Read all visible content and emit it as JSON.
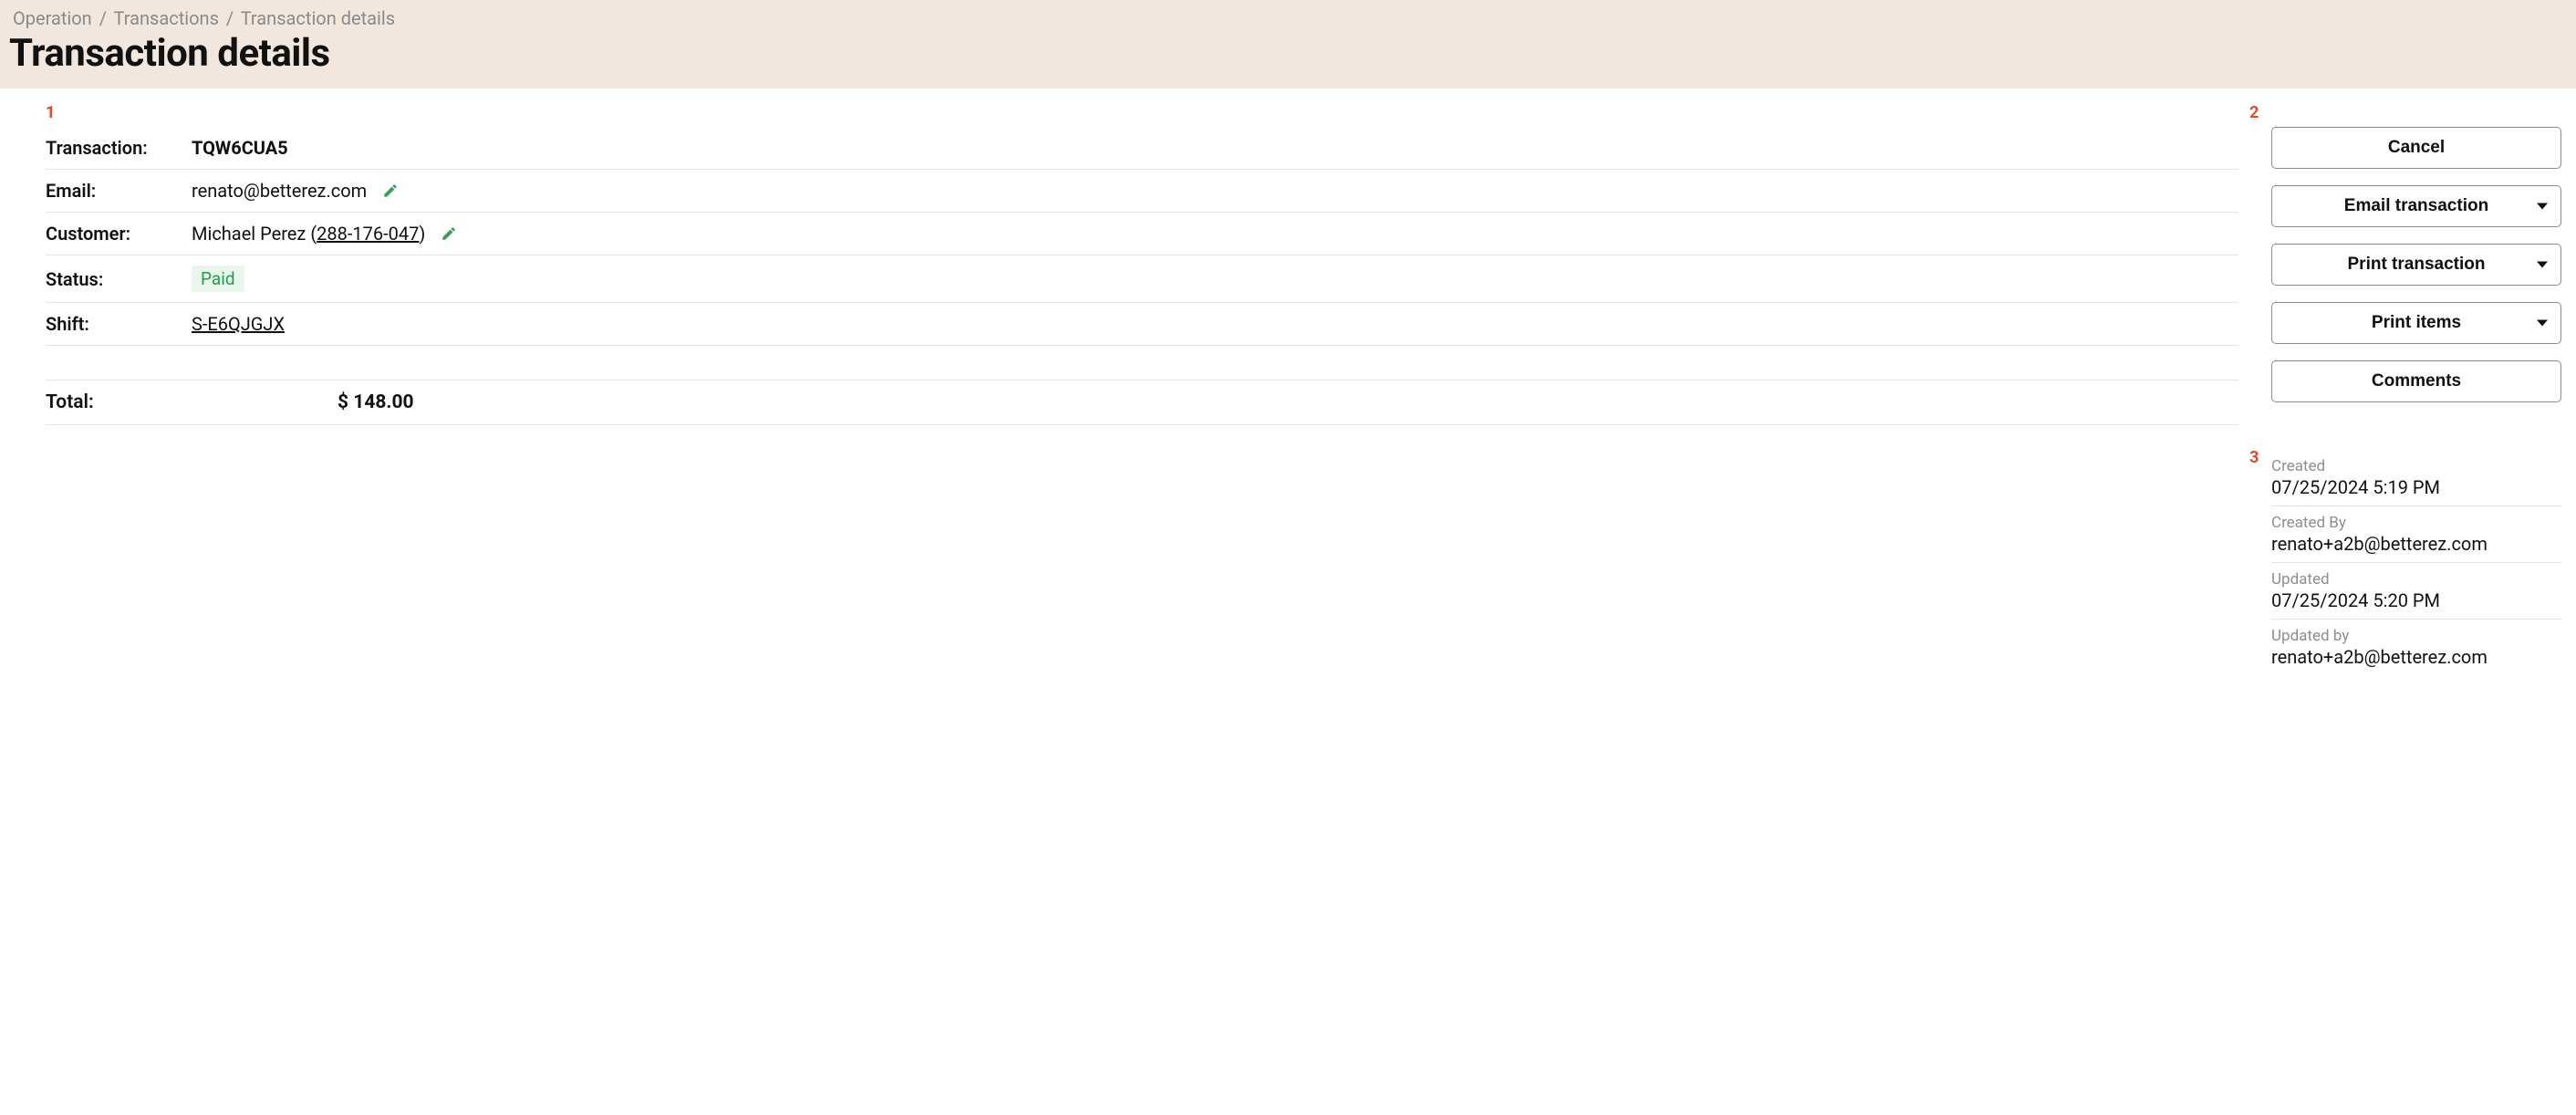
{
  "breadcrumb": {
    "items": [
      "Operation",
      "Transactions",
      "Transaction details"
    ],
    "sep": "/"
  },
  "header": {
    "title": "Transaction details"
  },
  "callouts": {
    "one": "1",
    "two": "2",
    "three": "3"
  },
  "details": {
    "transaction_label": "Transaction:",
    "transaction_value": "TQW6CUA5",
    "email_label": "Email:",
    "email_value": "renato@betterez.com",
    "customer_label": "Customer:",
    "customer_name": "Michael Perez",
    "customer_ref_open": "(",
    "customer_ref": "288-176-047",
    "customer_ref_close": ")",
    "status_label": "Status:",
    "status_value": "Paid",
    "shift_label": "Shift:",
    "shift_value": "S-E6QJGJX",
    "total_label": "Total:",
    "total_value": "$ 148.00"
  },
  "actions": {
    "cancel": "Cancel",
    "email_tx": "Email transaction",
    "print_tx": "Print transaction",
    "print_items": "Print items",
    "comments": "Comments"
  },
  "meta": {
    "created_label": "Created",
    "created_value": "07/25/2024 5:19 PM",
    "created_by_label": "Created By",
    "created_by_value": "renato+a2b@betterez.com",
    "updated_label": "Updated",
    "updated_value": "07/25/2024 5:20 PM",
    "updated_by_label": "Updated by",
    "updated_by_value": "renato+a2b@betterez.com"
  }
}
